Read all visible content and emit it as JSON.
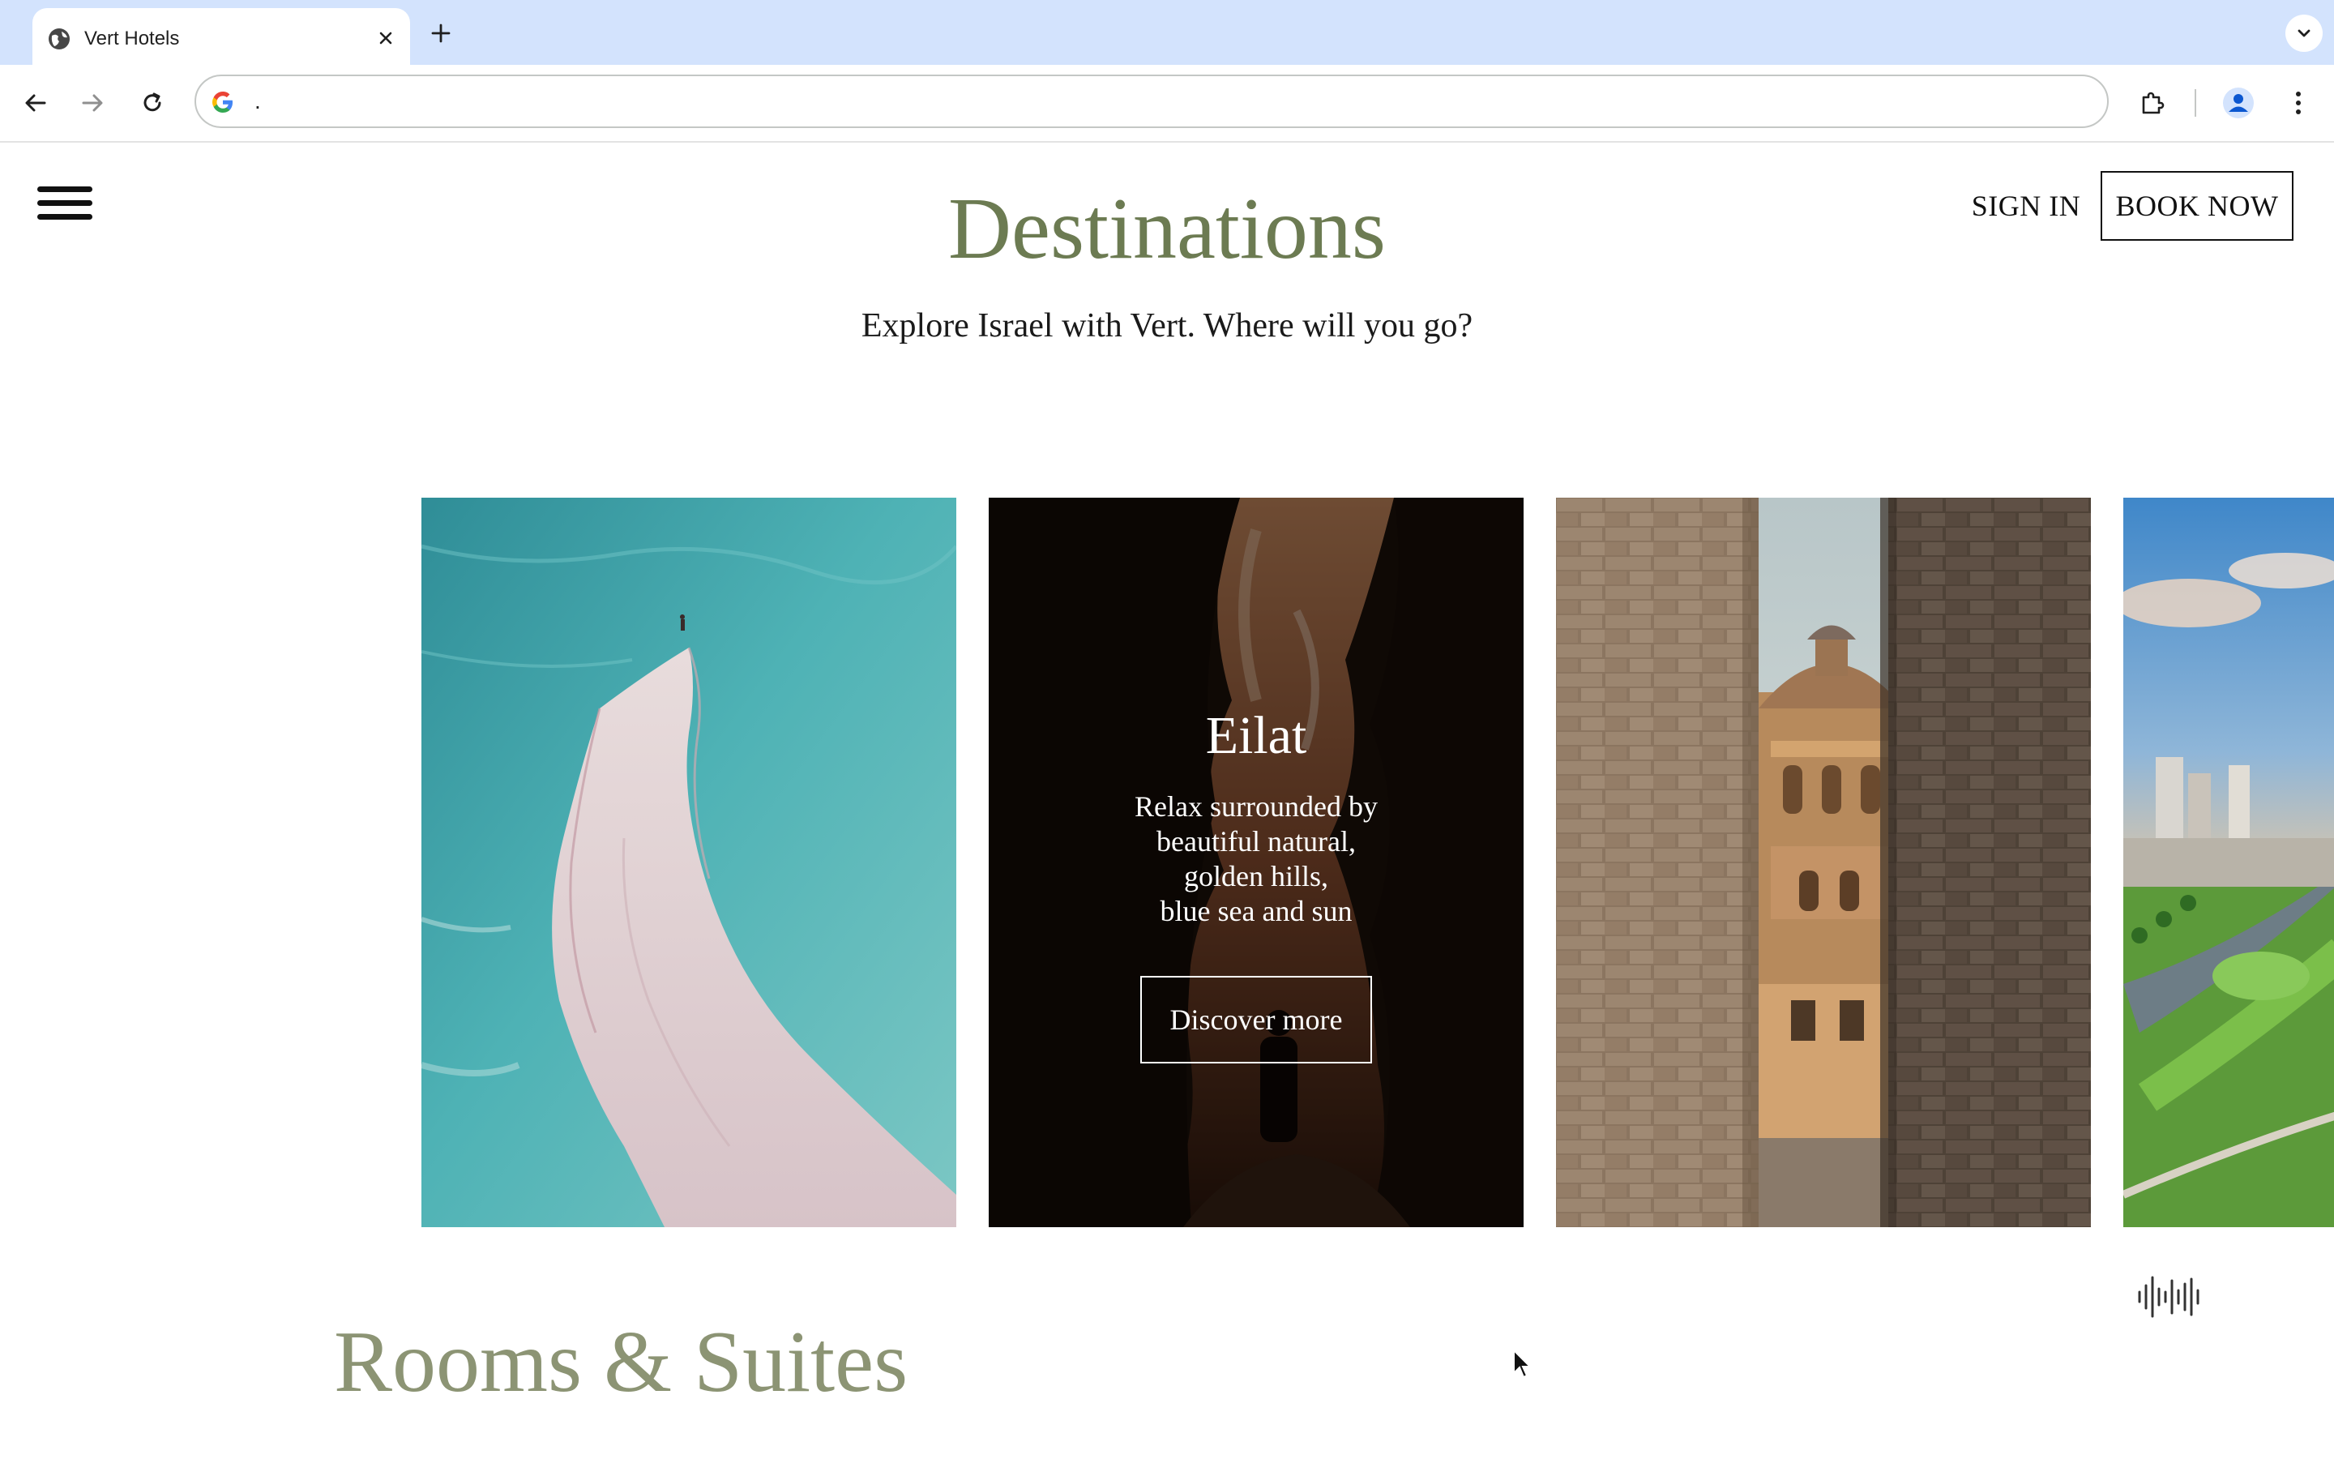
{
  "browser": {
    "tab_title": "Vert Hotels",
    "address_text": ".",
    "icons": {
      "tab_favicon": "globe-icon",
      "tab_close": "close-icon",
      "new_tab": "plus-icon",
      "tab_search": "chevron-down-icon",
      "back": "arrow-left-icon",
      "forward": "arrow-right-icon",
      "reload": "reload-icon",
      "omnibox": "google-g-icon",
      "extensions": "puzzle-icon",
      "profile": "person-icon",
      "menu": "vertical-dots-icon"
    }
  },
  "header": {
    "menu_icon": "hamburger-icon",
    "sign_in": "SIGN IN",
    "book_now": "BOOK NOW"
  },
  "destinations": {
    "title": "Destinations",
    "subtitle": "Explore Israel with Vert. Where will you go?",
    "cards": [
      {
        "scene": "dead-sea-salt-path"
      },
      {
        "scene": "desert-canyon",
        "title": "Eilat",
        "description": "Relax surrounded by\nbeautiful natural,\ngolden hills,\nblue sea and sun",
        "button": "Discover more"
      },
      {
        "scene": "jerusalem-old-city-alley"
      },
      {
        "scene": "tel-aviv-coast"
      }
    ]
  },
  "audio_icon": "sound-wave-icon",
  "rooms": {
    "title": "Rooms & Suites"
  },
  "colors": {
    "tab_strip": "#d3e3fd",
    "title_green": "#6c7b52",
    "rooms_green": "#8c9474"
  }
}
